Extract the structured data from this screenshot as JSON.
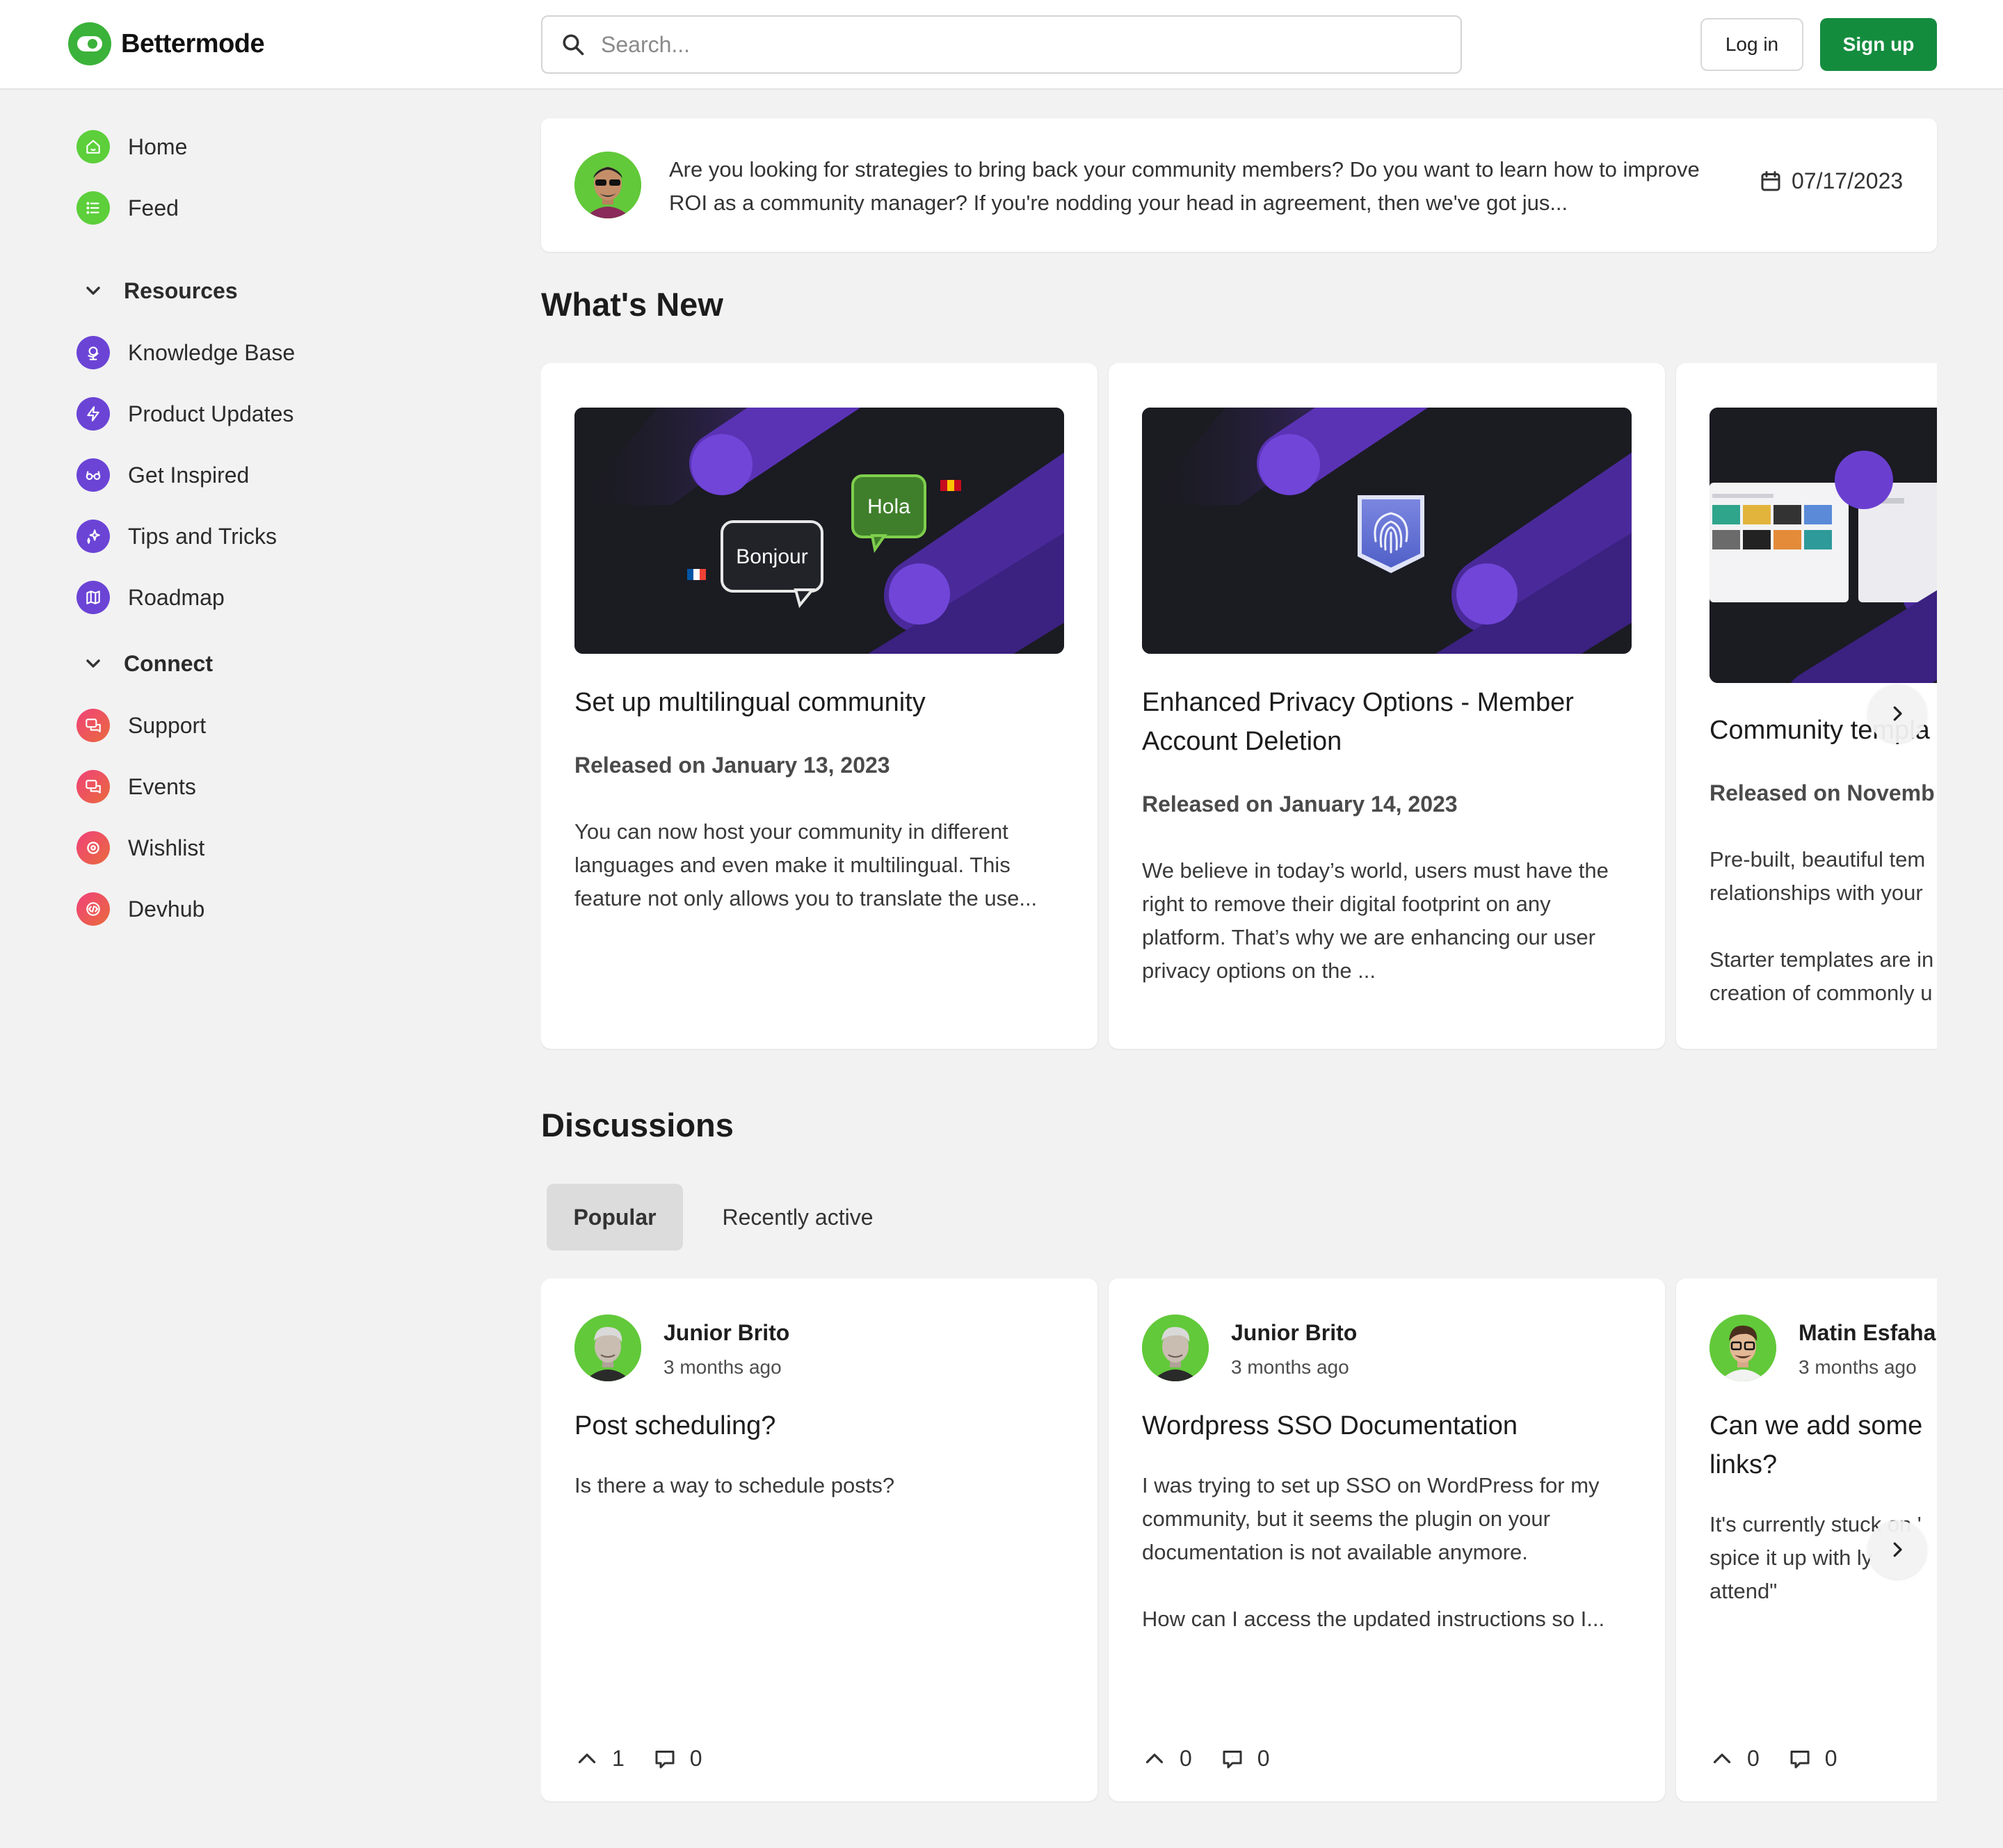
{
  "header": {
    "brand": "Bettermode",
    "search_placeholder": "Search...",
    "login_label": "Log in",
    "signup_label": "Sign up"
  },
  "colors": {
    "accent": "#148c3e",
    "brand_green": "#3bb23a",
    "icon_purple": "#6b44d6",
    "icon_pink": "#f0417a"
  },
  "sidebar": {
    "top_items": [
      {
        "label": "Home",
        "icon": "home-icon"
      },
      {
        "label": "Feed",
        "icon": "feed-icon"
      }
    ],
    "groups": [
      {
        "label": "Resources",
        "items": [
          {
            "label": "Knowledge Base",
            "icon": "globe-icon"
          },
          {
            "label": "Product Updates",
            "icon": "lightning-icon"
          },
          {
            "label": "Get Inspired",
            "icon": "glasses-icon"
          },
          {
            "label": "Tips and Tricks",
            "icon": "sparkle-icon"
          },
          {
            "label": "Roadmap",
            "icon": "map-icon"
          }
        ]
      },
      {
        "label": "Connect",
        "items": [
          {
            "label": "Support",
            "icon": "chat-icon"
          },
          {
            "label": "Events",
            "icon": "chat-icon"
          },
          {
            "label": "Wishlist",
            "icon": "lifebuoy-icon"
          },
          {
            "label": "Devhub",
            "icon": "code-icon"
          }
        ]
      }
    ]
  },
  "banner": {
    "text": "Are you looking for strategies to bring back your community members? Do you want to learn how to improve ROI as a community manager? If you're nodding your head in agreement, then we've got jus...",
    "date": "07/17/2023"
  },
  "whats_new": {
    "title": "What's New",
    "cards": [
      {
        "title": "Set up multilingual community",
        "meta": "Released on January 13, 2023",
        "body": "You can now host your community in different languages and even make it multilingual. This feature not only allows you to translate the use...",
        "image_labels": [
          "Hola",
          "Bonjour"
        ]
      },
      {
        "title": "Enhanced Privacy Options - Member Account Deletion",
        "meta": "Released on January 14, 2023",
        "body": "We believe in today’s world, users must have the right to remove their digital footprint on any platform. That’s why we are enhancing our user privacy options on the ..."
      },
      {
        "title": "Community templa",
        "meta": "Released on Novemb",
        "body": "Pre-built, beautiful tem relationships with your",
        "body2": "Starter templates are in creation of commonly u"
      }
    ]
  },
  "discussions": {
    "title": "Discussions",
    "tabs": [
      "Popular",
      "Recently active"
    ],
    "active_tab": "Popular",
    "posts": [
      {
        "author": "Junior Brito",
        "time": "3 months ago",
        "title": "Post scheduling?",
        "body": "Is there a way to schedule posts?",
        "body2": "",
        "upvotes": "1",
        "comments": "0"
      },
      {
        "author": "Junior Brito",
        "time": "3 months ago",
        "title": "Wordpress SSO Documentation",
        "body": "I was trying to set up SSO on WordPress for my community, but it seems the plugin on your documentation is not available anymore.",
        "body2": "How can I access the updated instructions so I...",
        "upvotes": "0",
        "comments": "0"
      },
      {
        "author": "Matin Esfahar",
        "time": "3 months ago",
        "title": "Can we add some links?",
        "body": "It's currently stuck on ' spice it up with ly attend\"",
        "body2": "",
        "upvotes": "0",
        "comments": "0"
      }
    ]
  }
}
